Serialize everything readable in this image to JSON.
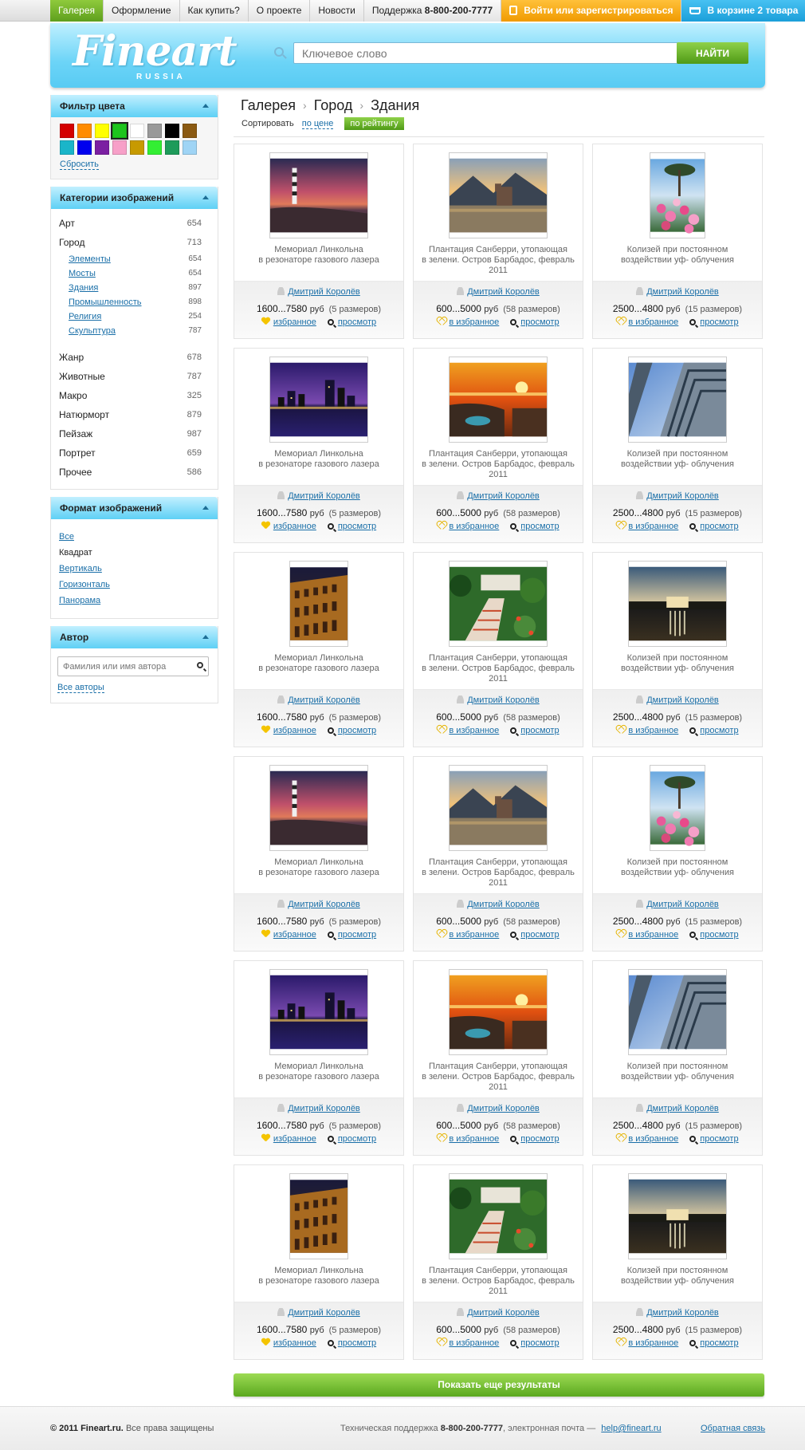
{
  "topnav": {
    "items": [
      {
        "label": "Галерея",
        "active": true
      },
      {
        "label": "Оформление"
      },
      {
        "label": "Как купить?"
      },
      {
        "label": "О проекте"
      },
      {
        "label": "Новости"
      }
    ],
    "support_label": "Поддержка",
    "support_phone": "8-800-200-7777",
    "login_label": "Войти или зарегистрироваться",
    "cart_label": "В корзине 2 товара"
  },
  "header": {
    "logo": "Fineart",
    "logo_sub": "RUSSIA",
    "search_placeholder": "Ключевое слово",
    "search_button": "НАЙТИ"
  },
  "sidebar": {
    "color_filter": {
      "title": "Фильтр цвета",
      "colors": [
        "#d40000",
        "#ff8c00",
        "#ffff00",
        "#1dc51d",
        "#ffffff",
        "#999999",
        "#000000",
        "#8b5a12",
        "#1ab5c9",
        "#0000ee",
        "#7b1fa2",
        "#f7a0c8",
        "#c79a00",
        "#33ee33",
        "#1e9b5a",
        "#9fd4f5"
      ],
      "selected_index": 3,
      "reset_label": "Сбросить"
    },
    "categories": {
      "title": "Категории изображений",
      "items": [
        {
          "label": "Арт",
          "count": "654"
        },
        {
          "label": "Город",
          "count": "713"
        }
      ],
      "subitems": [
        {
          "label": "Элементы",
          "count": "654"
        },
        {
          "label": "Мосты",
          "count": "654"
        },
        {
          "label": "Здания",
          "count": "897"
        },
        {
          "label": "Промышленность",
          "count": "898"
        },
        {
          "label": "Религия",
          "count": "254"
        },
        {
          "label": "Скульптура",
          "count": "787"
        }
      ],
      "items2": [
        {
          "label": "Жанр",
          "count": "678"
        },
        {
          "label": "Животные",
          "count": "787"
        },
        {
          "label": "Макро",
          "count": "325"
        },
        {
          "label": "Натюрморт",
          "count": "879"
        },
        {
          "label": "Пейзаж",
          "count": "987"
        },
        {
          "label": "Портрет",
          "count": "659"
        },
        {
          "label": "Прочее",
          "count": "586"
        }
      ]
    },
    "format": {
      "title": "Формат изображений",
      "items": [
        "Все",
        "Квадрат",
        "Вертикаль",
        "Горизонталь",
        "Панорама"
      ]
    },
    "author": {
      "title": "Автор",
      "placeholder": "Фамилия или имя автора",
      "all_label": "Все авторы"
    }
  },
  "main": {
    "breadcrumb": [
      "Галерея",
      "Город",
      "Здания"
    ],
    "sort_label": "Сортировать",
    "sort_price": "по цене",
    "sort_rating": "по рейтингу",
    "more_button": "Показать еще результаты"
  },
  "cards": [
    {
      "title1": "Мемориал Линкольна",
      "title2": "в резонаторе газового лазера",
      "author": "Дмитрий Королёв",
      "price": "1600...7580",
      "currency": "руб",
      "sizes": "(5 размеров)",
      "fav": "избранное",
      "fav_filled": true,
      "view": "просмотр",
      "image": "lighthouse-sunset"
    },
    {
      "title1": "Плантация Санберри, утопающая",
      "title2": "в зелени. Остров Барбадос, февраль 2011",
      "author": "Дмитрий Королёв",
      "price": "600...5000",
      "currency": "руб",
      "sizes": "(58 размеров)",
      "fav": "в избранное",
      "fav_filled": false,
      "view": "просмотр",
      "image": "castle-lake"
    },
    {
      "title1": "Колизей при постоянном",
      "title2": "воздействии уф- облучения",
      "author": "Дмитрий Королёв",
      "price": "2500...4800",
      "currency": "руб",
      "sizes": "(15 размеров)",
      "fav": "в избранное",
      "fav_filled": false,
      "view": "просмотр",
      "image": "flowers-sea"
    },
    {
      "title1": "Мемориал Линкольна",
      "title2": "в резонаторе газового лазера",
      "author": "Дмитрий Королёв",
      "price": "1600...7580",
      "currency": "руб",
      "sizes": "(5 размеров)",
      "fav": "избранное",
      "fav_filled": true,
      "view": "просмотр",
      "image": "night-city"
    },
    {
      "title1": "Плантация Санберри, утопающая",
      "title2": "в зелени. Остров Барбадос, февраль 2011",
      "author": "Дмитрий Королёв",
      "price": "600...5000",
      "currency": "руб",
      "sizes": "(58 размеров)",
      "fav": "в избранное",
      "fav_filled": false,
      "view": "просмотр",
      "image": "resort-sunset"
    },
    {
      "title1": "Колизей при постоянном",
      "title2": "воздействии уф- облучения",
      "author": "Дмитрий Королёв",
      "price": "2500...4800",
      "currency": "руб",
      "sizes": "(15 размеров)",
      "fav": "в избранное",
      "fav_filled": false,
      "view": "просмотр",
      "image": "skyscraper"
    },
    {
      "title1": "Мемориал Линкольна",
      "title2": "в резонаторе газового лазера",
      "author": "Дмитрий Королёв",
      "price": "1600...7580",
      "currency": "руб",
      "sizes": "(5 размеров)",
      "fav": "избранное",
      "fav_filled": true,
      "view": "просмотр",
      "image": "colosseum"
    },
    {
      "title1": "Плантация Санберри, утопающая",
      "title2": "в зелени. Остров Барбадос, февраль 2011",
      "author": "Дмитрий Королёв",
      "price": "600...5000",
      "currency": "руб",
      "sizes": "(58 размеров)",
      "fav": "в избранное",
      "fav_filled": false,
      "view": "просмотр",
      "image": "tropical-stairs"
    },
    {
      "title1": "Колизей при постоянном",
      "title2": "воздействии уф- облучения",
      "author": "Дмитрий Королёв",
      "price": "2500...4800",
      "currency": "руб",
      "sizes": "(15 размеров)",
      "fav": "в избранное",
      "fav_filled": false,
      "view": "просмотр",
      "image": "lincoln-memorial"
    },
    {
      "title1": "Мемориал Линкольна",
      "title2": "в резонаторе газового лазера",
      "author": "Дмитрий Королёв",
      "price": "1600...7580",
      "currency": "руб",
      "sizes": "(5 размеров)",
      "fav": "избранное",
      "fav_filled": true,
      "view": "просмотр",
      "image": "lighthouse-sunset"
    },
    {
      "title1": "Плантация Санберри, утопающая",
      "title2": "в зелени. Остров Барбадос, февраль 2011",
      "author": "Дмитрий Королёв",
      "price": "600...5000",
      "currency": "руб",
      "sizes": "(58 размеров)",
      "fav": "в избранное",
      "fav_filled": false,
      "view": "просмотр",
      "image": "castle-lake"
    },
    {
      "title1": "Колизей при постоянном",
      "title2": "воздействии уф- облучения",
      "author": "Дмитрий Королёв",
      "price": "2500...4800",
      "currency": "руб",
      "sizes": "(15 размеров)",
      "fav": "в избранное",
      "fav_filled": false,
      "view": "просмотр",
      "image": "flowers-sea"
    },
    {
      "title1": "Мемориал Линкольна",
      "title2": "в резонаторе газового лазера",
      "author": "Дмитрий Королёв",
      "price": "1600...7580",
      "currency": "руб",
      "sizes": "(5 размеров)",
      "fav": "избранное",
      "fav_filled": true,
      "view": "просмотр",
      "image": "night-city"
    },
    {
      "title1": "Плантация Санберри, утопающая",
      "title2": "в зелени. Остров Барбадос, февраль 2011",
      "author": "Дмитрий Королёв",
      "price": "600...5000",
      "currency": "руб",
      "sizes": "(58 размеров)",
      "fav": "в избранное",
      "fav_filled": false,
      "view": "просмотр",
      "image": "resort-sunset"
    },
    {
      "title1": "Колизей при постоянном",
      "title2": "воздействии уф- облучения",
      "author": "Дмитрий Королёв",
      "price": "2500...4800",
      "currency": "руб",
      "sizes": "(15 размеров)",
      "fav": "в избранное",
      "fav_filled": false,
      "view": "просмотр",
      "image": "skyscraper"
    },
    {
      "title1": "Мемориал Линкольна",
      "title2": "в резонаторе газового лазера",
      "author": "Дмитрий Королёв",
      "price": "1600...7580",
      "currency": "руб",
      "sizes": "(5 размеров)",
      "fav": "избранное",
      "fav_filled": true,
      "view": "просмотр",
      "image": "colosseum"
    },
    {
      "title1": "Плантация Санберри, утопающая",
      "title2": "в зелени. Остров Барбадос, февраль 2011",
      "author": "Дмитрий Королёв",
      "price": "600...5000",
      "currency": "руб",
      "sizes": "(58 размеров)",
      "fav": "в избранное",
      "fav_filled": false,
      "view": "просмотр",
      "image": "tropical-stairs"
    },
    {
      "title1": "Колизей при постоянном",
      "title2": "воздействии уф- облучения",
      "author": "Дмитрий Королёв",
      "price": "2500...4800",
      "currency": "руб",
      "sizes": "(15 размеров)",
      "fav": "в избранное",
      "fav_filled": false,
      "view": "просмотр",
      "image": "lincoln-memorial"
    }
  ],
  "footer": {
    "copyright": "© 2011 Fineart.ru.",
    "rights": "Все права защищены",
    "support_text": "Техническая поддержка",
    "support_phone": "8-800-200-7777",
    "email_text": ", электронная почта —",
    "email": "help@fineart.ru",
    "feedback": "Обратная связь"
  }
}
